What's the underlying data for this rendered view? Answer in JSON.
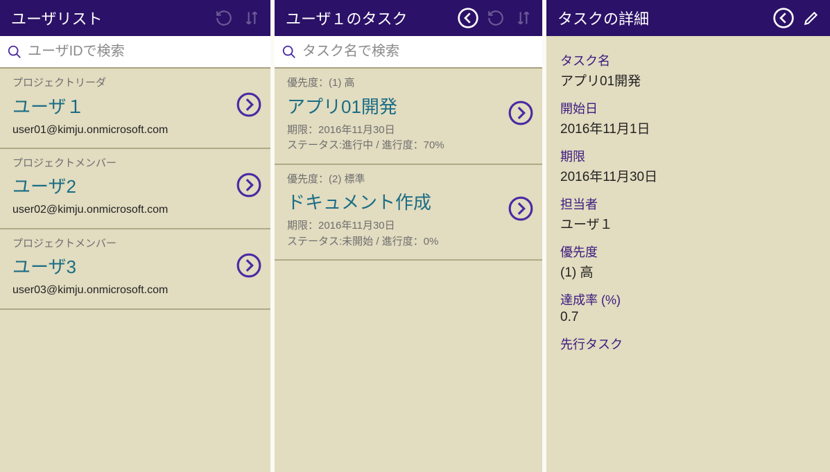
{
  "users_pane": {
    "title": "ユーザリスト",
    "search_placeholder": "ユーザIDで検索",
    "items": [
      {
        "role": "プロジェクトリーダ",
        "name": "ユーザ１",
        "email": "user01@kimju.onmicrosoft.com"
      },
      {
        "role": "プロジェクトメンバー",
        "name": "ユーザ2",
        "email": "user02@kimju.onmicrosoft.com"
      },
      {
        "role": "プロジェクトメンバー",
        "name": "ユーザ3",
        "email": "user03@kimju.onmicrosoft.com"
      }
    ]
  },
  "tasks_pane": {
    "title": "ユーザ１のタスク",
    "search_placeholder": "タスク名で検索",
    "items": [
      {
        "priority": "優先度：(1) 高",
        "name": "アプリ01開発",
        "due": "期限：2016年11月30日",
        "status": "ステータス:進行中 / 進行度：70%"
      },
      {
        "priority": "優先度：(2) 標準",
        "name": "ドキュメント作成",
        "due": "期限：2016年11月30日",
        "status": "ステータス:未開始 / 進行度：0%"
      }
    ]
  },
  "detail_pane": {
    "title": "タスクの詳細",
    "fields": {
      "task_name_label": "タスク名",
      "task_name": "アプリ01開発",
      "start_label": "開始日",
      "start": "2016年11月1日",
      "due_label": "期限",
      "due": "2016年11月30日",
      "assignee_label": "担当者",
      "assignee": "ユーザ１",
      "priority_label": "優先度",
      "priority": "(1) 高",
      "progress_label": "達成率 (%)",
      "progress": "0.7",
      "predecessor_label": "先行タスク",
      "predecessor": ""
    }
  }
}
